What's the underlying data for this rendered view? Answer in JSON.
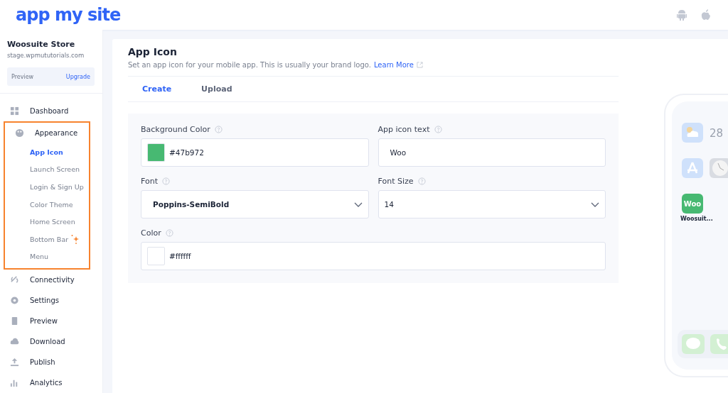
{
  "header": {
    "logo": "app my site"
  },
  "sidebar": {
    "store_name": "Woosuite Store",
    "store_url": "stage.wpmututorials.com",
    "plan": {
      "label": "Preview",
      "action": "Upgrade"
    },
    "items": [
      {
        "label": "Dashboard"
      },
      {
        "label": "Appearance",
        "children": [
          {
            "label": "App Icon",
            "selected": true,
            "sparkle": false
          },
          {
            "label": "Launch Screen",
            "selected": false,
            "sparkle": false
          },
          {
            "label": "Login & Sign Up",
            "selected": false,
            "sparkle": false
          },
          {
            "label": "Color Theme",
            "selected": false,
            "sparkle": false
          },
          {
            "label": "Home Screen",
            "selected": false,
            "sparkle": false
          },
          {
            "label": "Bottom Bar",
            "selected": false,
            "sparkle": true
          },
          {
            "label": "Menu",
            "selected": false,
            "sparkle": false
          }
        ]
      },
      {
        "label": "Connectivity"
      },
      {
        "label": "Settings"
      },
      {
        "label": "Preview"
      },
      {
        "label": "Download"
      },
      {
        "label": "Publish"
      },
      {
        "label": "Analytics"
      }
    ]
  },
  "page": {
    "title": "App Icon",
    "description": "Set an app icon for your mobile app. This is usually your brand logo.",
    "link": "Learn More",
    "tabs": [
      {
        "label": "Create",
        "selected": true
      },
      {
        "label": "Upload",
        "selected": false
      }
    ],
    "fields": [
      {
        "kind": "color",
        "label": "Background Color",
        "value": "#47b972",
        "color": "#47b972",
        "wide": false
      },
      {
        "kind": "text",
        "label": "App icon text",
        "value": "Woo",
        "wide": false
      },
      {
        "kind": "select",
        "label": "Font",
        "value": "Poppins-SemiBold",
        "bold": true,
        "wide": false
      },
      {
        "kind": "select",
        "label": "Font Size",
        "value": "14",
        "bold": false,
        "wide": false
      },
      {
        "kind": "color",
        "label": "Color",
        "value": "#ffffff",
        "color": "#ffffff",
        "wide": true
      }
    ]
  },
  "phone": {
    "date": "28",
    "apps": [
      {
        "kind": "weather"
      },
      {
        "kind": "calendar"
      },
      {
        "kind": "store"
      },
      {
        "kind": "clock"
      },
      {
        "kind": "custom",
        "label": "Woosuit...",
        "text": "Woo",
        "color": "#47b972"
      }
    ]
  }
}
